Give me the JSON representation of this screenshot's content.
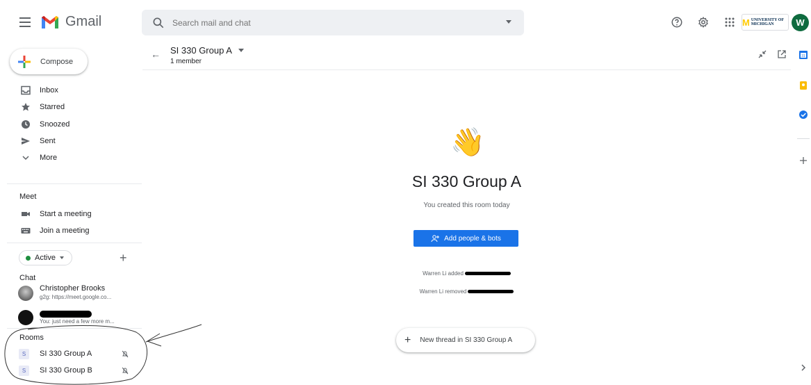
{
  "header": {
    "app_name": "Gmail",
    "search_placeholder": "Search mail and chat",
    "org_logo_text": "UNIVERSITY OF MICHIGAN",
    "avatar_initial": "W",
    "icons": [
      "help-icon",
      "settings-icon",
      "apps-grid-icon"
    ]
  },
  "sidebar": {
    "compose_label": "Compose",
    "mail_items": [
      {
        "label": "Inbox",
        "icon": "inbox-icon"
      },
      {
        "label": "Starred",
        "icon": "star-icon"
      },
      {
        "label": "Snoozed",
        "icon": "clock-icon"
      },
      {
        "label": "Sent",
        "icon": "send-icon"
      },
      {
        "label": "More",
        "icon": "chevron-down-icon"
      }
    ],
    "meet": {
      "heading": "Meet",
      "items": [
        {
          "label": "Start a meeting",
          "icon": "video-icon"
        },
        {
          "label": "Join a meeting",
          "icon": "keyboard-icon"
        }
      ]
    },
    "status_label": "Active",
    "chat": {
      "heading": "Chat",
      "contacts": [
        {
          "name": "Christopher Brooks",
          "preview": "g2g: https://meet.google.co..."
        },
        {
          "name": "",
          "preview": "You: just need a few more m..."
        }
      ]
    },
    "rooms": {
      "heading": "Rooms",
      "items": [
        {
          "avatar": "S",
          "name": "SI 330 Group A"
        },
        {
          "avatar": "S",
          "name": "SI 330 Group B"
        }
      ]
    }
  },
  "room": {
    "title": "SI 330 Group A",
    "member_count": "1 member",
    "welcome_emoji": "👋",
    "big_title": "SI 330 Group A",
    "created_text": "You created this room today",
    "add_button_label": "Add people & bots",
    "log": [
      {
        "text": "Warren Li added"
      },
      {
        "text": "Warren Li removed"
      }
    ],
    "new_thread_label": "New thread in SI 330 Group A"
  },
  "colors": {
    "primary_blue": "#1a73e8",
    "active_green": "#1e8e3e",
    "room_avatar_bg": "#e8eaf6"
  }
}
